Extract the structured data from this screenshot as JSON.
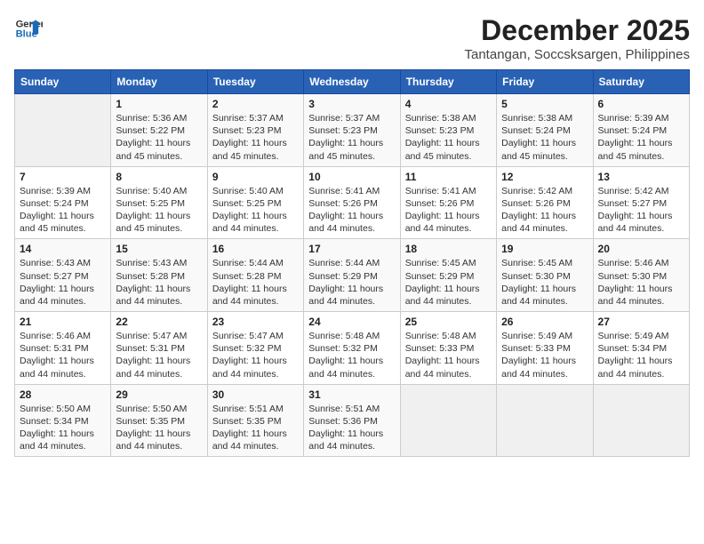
{
  "logo": {
    "line1": "General",
    "line2": "Blue"
  },
  "title": "December 2025",
  "location": "Tantangan, Soccsksargen, Philippines",
  "days_header": [
    "Sunday",
    "Monday",
    "Tuesday",
    "Wednesday",
    "Thursday",
    "Friday",
    "Saturday"
  ],
  "weeks": [
    [
      {
        "day": "",
        "info": ""
      },
      {
        "day": "1",
        "info": "Sunrise: 5:36 AM\nSunset: 5:22 PM\nDaylight: 11 hours\nand 45 minutes."
      },
      {
        "day": "2",
        "info": "Sunrise: 5:37 AM\nSunset: 5:23 PM\nDaylight: 11 hours\nand 45 minutes."
      },
      {
        "day": "3",
        "info": "Sunrise: 5:37 AM\nSunset: 5:23 PM\nDaylight: 11 hours\nand 45 minutes."
      },
      {
        "day": "4",
        "info": "Sunrise: 5:38 AM\nSunset: 5:23 PM\nDaylight: 11 hours\nand 45 minutes."
      },
      {
        "day": "5",
        "info": "Sunrise: 5:38 AM\nSunset: 5:24 PM\nDaylight: 11 hours\nand 45 minutes."
      },
      {
        "day": "6",
        "info": "Sunrise: 5:39 AM\nSunset: 5:24 PM\nDaylight: 11 hours\nand 45 minutes."
      }
    ],
    [
      {
        "day": "7",
        "info": "Sunrise: 5:39 AM\nSunset: 5:24 PM\nDaylight: 11 hours\nand 45 minutes."
      },
      {
        "day": "8",
        "info": "Sunrise: 5:40 AM\nSunset: 5:25 PM\nDaylight: 11 hours\nand 45 minutes."
      },
      {
        "day": "9",
        "info": "Sunrise: 5:40 AM\nSunset: 5:25 PM\nDaylight: 11 hours\nand 44 minutes."
      },
      {
        "day": "10",
        "info": "Sunrise: 5:41 AM\nSunset: 5:26 PM\nDaylight: 11 hours\nand 44 minutes."
      },
      {
        "day": "11",
        "info": "Sunrise: 5:41 AM\nSunset: 5:26 PM\nDaylight: 11 hours\nand 44 minutes."
      },
      {
        "day": "12",
        "info": "Sunrise: 5:42 AM\nSunset: 5:26 PM\nDaylight: 11 hours\nand 44 minutes."
      },
      {
        "day": "13",
        "info": "Sunrise: 5:42 AM\nSunset: 5:27 PM\nDaylight: 11 hours\nand 44 minutes."
      }
    ],
    [
      {
        "day": "14",
        "info": "Sunrise: 5:43 AM\nSunset: 5:27 PM\nDaylight: 11 hours\nand 44 minutes."
      },
      {
        "day": "15",
        "info": "Sunrise: 5:43 AM\nSunset: 5:28 PM\nDaylight: 11 hours\nand 44 minutes."
      },
      {
        "day": "16",
        "info": "Sunrise: 5:44 AM\nSunset: 5:28 PM\nDaylight: 11 hours\nand 44 minutes."
      },
      {
        "day": "17",
        "info": "Sunrise: 5:44 AM\nSunset: 5:29 PM\nDaylight: 11 hours\nand 44 minutes."
      },
      {
        "day": "18",
        "info": "Sunrise: 5:45 AM\nSunset: 5:29 PM\nDaylight: 11 hours\nand 44 minutes."
      },
      {
        "day": "19",
        "info": "Sunrise: 5:45 AM\nSunset: 5:30 PM\nDaylight: 11 hours\nand 44 minutes."
      },
      {
        "day": "20",
        "info": "Sunrise: 5:46 AM\nSunset: 5:30 PM\nDaylight: 11 hours\nand 44 minutes."
      }
    ],
    [
      {
        "day": "21",
        "info": "Sunrise: 5:46 AM\nSunset: 5:31 PM\nDaylight: 11 hours\nand 44 minutes."
      },
      {
        "day": "22",
        "info": "Sunrise: 5:47 AM\nSunset: 5:31 PM\nDaylight: 11 hours\nand 44 minutes."
      },
      {
        "day": "23",
        "info": "Sunrise: 5:47 AM\nSunset: 5:32 PM\nDaylight: 11 hours\nand 44 minutes."
      },
      {
        "day": "24",
        "info": "Sunrise: 5:48 AM\nSunset: 5:32 PM\nDaylight: 11 hours\nand 44 minutes."
      },
      {
        "day": "25",
        "info": "Sunrise: 5:48 AM\nSunset: 5:33 PM\nDaylight: 11 hours\nand 44 minutes."
      },
      {
        "day": "26",
        "info": "Sunrise: 5:49 AM\nSunset: 5:33 PM\nDaylight: 11 hours\nand 44 minutes."
      },
      {
        "day": "27",
        "info": "Sunrise: 5:49 AM\nSunset: 5:34 PM\nDaylight: 11 hours\nand 44 minutes."
      }
    ],
    [
      {
        "day": "28",
        "info": "Sunrise: 5:50 AM\nSunset: 5:34 PM\nDaylight: 11 hours\nand 44 minutes."
      },
      {
        "day": "29",
        "info": "Sunrise: 5:50 AM\nSunset: 5:35 PM\nDaylight: 11 hours\nand 44 minutes."
      },
      {
        "day": "30",
        "info": "Sunrise: 5:51 AM\nSunset: 5:35 PM\nDaylight: 11 hours\nand 44 minutes."
      },
      {
        "day": "31",
        "info": "Sunrise: 5:51 AM\nSunset: 5:36 PM\nDaylight: 11 hours\nand 44 minutes."
      },
      {
        "day": "",
        "info": ""
      },
      {
        "day": "",
        "info": ""
      },
      {
        "day": "",
        "info": ""
      }
    ]
  ]
}
